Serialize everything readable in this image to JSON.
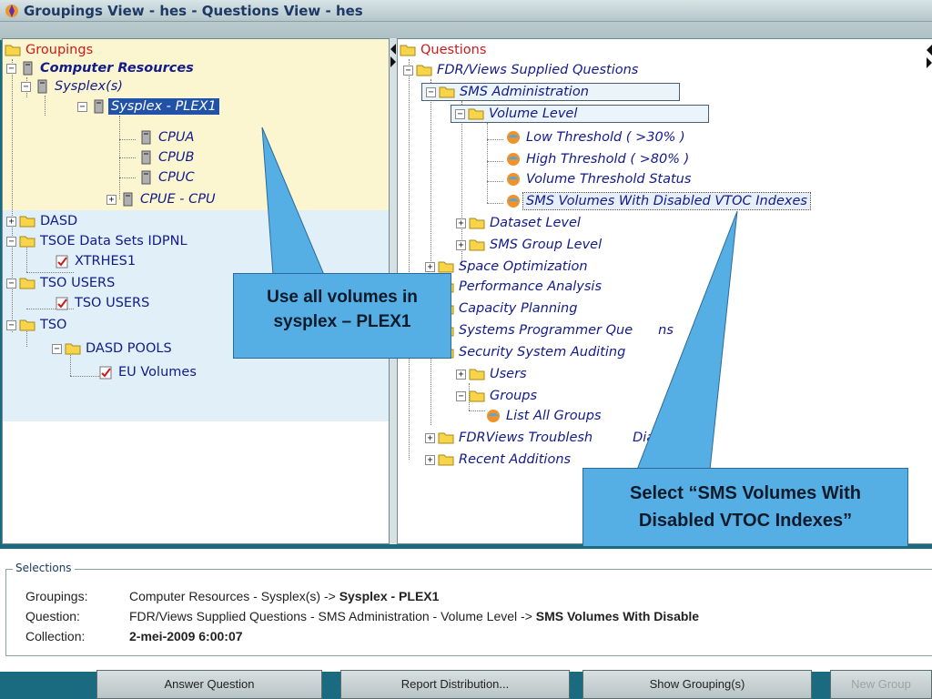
{
  "window": {
    "title": "Groupings View - hes  -  Questions View - hes"
  },
  "left_tree": {
    "root": "Groupings",
    "computer_resources": "Computer Resources",
    "sysplexes": "Sysplex(s)",
    "sysplex_plex1": "Sysplex - PLEX1",
    "cpua": "CPUA",
    "cpub": "CPUB",
    "cpuc": "CPUC",
    "cpue": "CPUE - CPU",
    "dasd": "DASD",
    "tsoe_datasets": "TSOE Data Sets IDPNL",
    "xtrhes1": "XTRHES1",
    "tso_users_folder": "TSO USERS",
    "tso_users_item": "TSO USERS",
    "tso": "TSO",
    "dasd_pools": "DASD POOLS",
    "eu_volumes": "EU Volumes"
  },
  "right_tree": {
    "root": "Questions",
    "fdrviews_supplied": "FDR/Views Supplied Questions",
    "sms_admin": "SMS Administration",
    "volume_level": "Volume Level",
    "low_threshold": "Low Threshold ( >30% )",
    "high_threshold": "High Threshold ( >80% )",
    "volume_threshold_status": "Volume Threshold Status",
    "sms_volumes_disabled_vtoc": "SMS Volumes With Disabled VTOC Indexes",
    "dataset_level": "Dataset Level",
    "sms_group_level": "SMS Group Level",
    "space_optimization": "Space Optimization",
    "performance_analysis": "Performance Analysis",
    "capacity_planning": "Capacity Planning",
    "systems_programmer": "Systems Programmer Que",
    "systems_programmer_tail": "ns",
    "security_auditing": "Security System Auditing",
    "users": "Users",
    "groups": "Groups",
    "list_all_groups": "List All Groups",
    "fdrviews_troubleshoot": "FDRViews Troublesh",
    "fdrviews_troubleshoot_tail": "Diagnosis)",
    "recent_additions": "Recent Additions"
  },
  "callouts": {
    "left_line1": "Use all volumes in",
    "left_line2": "sysplex – PLEX1",
    "right_line1": "Select “SMS Volumes With",
    "right_line2": "Disabled VTOC Indexes”"
  },
  "selections": {
    "legend": "Selections",
    "groupings_label": "Groupings:",
    "groupings_path": "Computer Resources - Sysplex(s) -> ",
    "groupings_value": "Sysplex - PLEX1",
    "question_label": "Question:",
    "question_path": "FDR/Views Supplied Questions - SMS Administration - Volume Level -> ",
    "question_value": "SMS Volumes With Disable",
    "collection_label": "Collection:",
    "collection_value": "2-mei-2009 6:00:07"
  },
  "buttons": {
    "answer": "Answer Question",
    "report": "Report Distribution...",
    "show": "Show Grouping(s)",
    "new_group": "New Group"
  },
  "colors": {
    "accent": "#1a6a80",
    "selected": "#2252a8",
    "callout": "#55afe4",
    "tree_text": "#121a8c",
    "root_text": "#d01818"
  }
}
